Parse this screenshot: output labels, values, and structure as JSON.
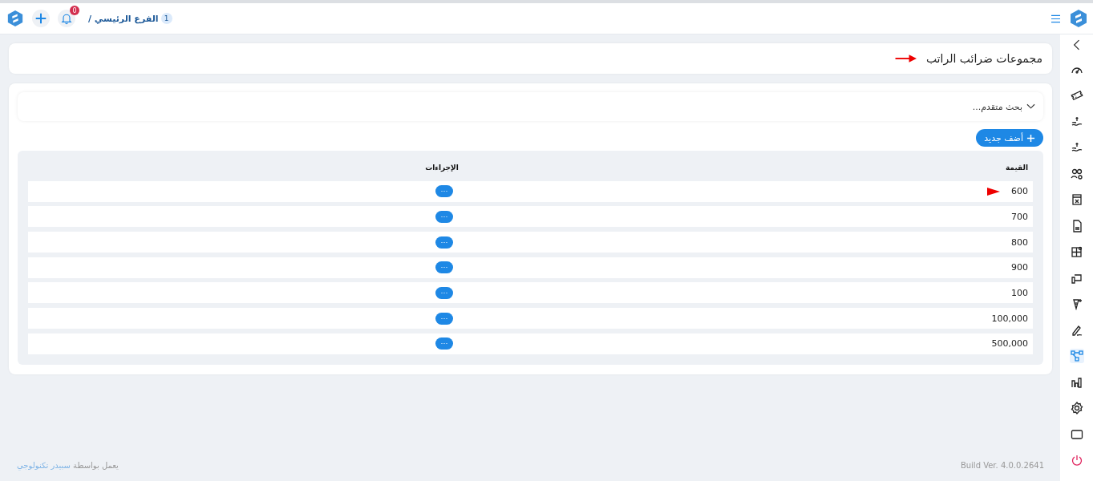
{
  "topbar": {
    "branch_number": "1",
    "branch": "الفرع الرئيسي /",
    "notifications": "0"
  },
  "sidebar": {
    "items": [
      {
        "selected": false
      },
      {
        "selected": false
      },
      {
        "selected": false
      },
      {
        "selected": false
      },
      {
        "selected": false
      },
      {
        "selected": false
      },
      {
        "selected": false
      },
      {
        "selected": false
      },
      {
        "selected": false
      },
      {
        "selected": false
      },
      {
        "selected": false
      },
      {
        "selected": true
      },
      {
        "selected": false
      },
      {
        "selected": false
      },
      {
        "selected": false
      },
      {
        "selected": false
      }
    ]
  },
  "page": {
    "title": "مجموعات ضرائب الراتب"
  },
  "advanced_search": {
    "label": "بحث متقدم...",
    "expanded": false
  },
  "add_button": "أضف جديد",
  "table": {
    "columns": [
      "القيمة",
      "الإجراءات"
    ],
    "rows": [
      {
        "value": "600",
        "action": "···"
      },
      {
        "value": "700",
        "action": "···"
      },
      {
        "value": "800",
        "action": "···"
      },
      {
        "value": "900",
        "action": "···"
      },
      {
        "value": "100",
        "action": "···"
      },
      {
        "value": "100,000",
        "action": "···"
      },
      {
        "value": "500,000",
        "action": "···"
      }
    ]
  },
  "footer": {
    "powered_by": "يعمل بواسطة",
    "company": "سبيدر تكنولوجي",
    "build": "Build Ver. 4.0.0.2641"
  }
}
